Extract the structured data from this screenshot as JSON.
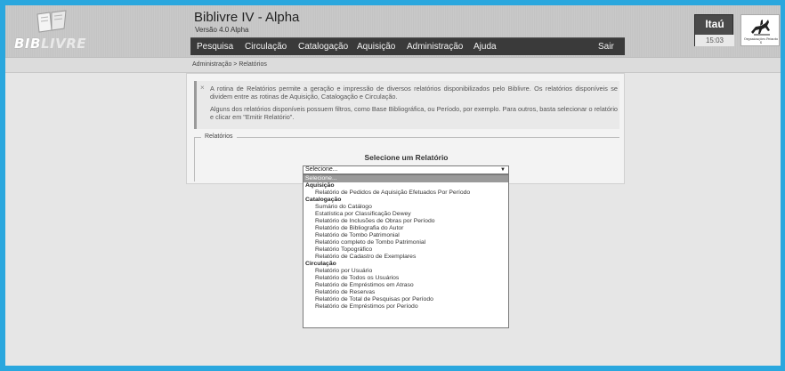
{
  "app": {
    "title": "Biblivre IV - Alpha",
    "version": "Versão 4.0 Alpha",
    "logo_text_a": "BIB",
    "logo_text_b": "LIVRE"
  },
  "menu": {
    "items": [
      "Pesquisa",
      "Circulação",
      "Catalogação",
      "Aquisição",
      "Administração",
      "Ajuda"
    ],
    "logout": "Sair"
  },
  "bank": {
    "name": "Itaú",
    "time": "15:03"
  },
  "org": {
    "text": "Organizações Peixoto S"
  },
  "breadcrumb": "Administração > Relatórios",
  "info": {
    "close_icon": "×",
    "p1": "A rotina de Relatórios permite a geração e impressão de diversos relatórios disponibilizados pelo Biblivre. Os relatórios disponíveis se dividem entre as rotinas de Aquisição, Catalogação e Circulação.",
    "p2": "Alguns dos relatórios disponíveis possuem filtros, como Base Bibliográfica, ou Período, por exemplo. Para outros, basta selecionar o relatório e clicar em \"Emitir Relatório\"."
  },
  "reports": {
    "legend": "Relatórios",
    "heading": "Selecione um Relatório",
    "selected": "Selecione...",
    "arrow": "▼",
    "options": [
      {
        "type": "selected",
        "label": "Selecione..."
      },
      {
        "type": "group",
        "label": "Aquisição"
      },
      {
        "type": "opt",
        "label": "Relatório de Pedidos de Aquisição Efetuados Por Período"
      },
      {
        "type": "group",
        "label": "Catalogação"
      },
      {
        "type": "opt",
        "label": "Sumário do Catálogo"
      },
      {
        "type": "opt",
        "label": "Estatística por Classificação Dewey"
      },
      {
        "type": "opt",
        "label": "Relatório de Inclusões de Obras por Período"
      },
      {
        "type": "opt",
        "label": "Relatório de Bibliografia do Autor"
      },
      {
        "type": "opt",
        "label": "Relatório de Tombo Patrimonial"
      },
      {
        "type": "opt",
        "label": "Relatório completo de Tombo Patrimonial"
      },
      {
        "type": "opt",
        "label": "Relatório Topográfico"
      },
      {
        "type": "opt",
        "label": "Relatório de Cadastro de Exemplares"
      },
      {
        "type": "group",
        "label": "Circulação"
      },
      {
        "type": "opt",
        "label": "Relatório por Usuário"
      },
      {
        "type": "opt",
        "label": "Relatório de Todos os Usuários"
      },
      {
        "type": "opt",
        "label": "Relatório de Empréstimos em Atraso"
      },
      {
        "type": "opt",
        "label": "Relatório de Reservas"
      },
      {
        "type": "opt",
        "label": "Relatório de Total de Pesquisas por Período"
      },
      {
        "type": "opt",
        "label": "Relatório de Empréstimos por Período"
      }
    ]
  },
  "colors": {
    "frame": "#2aa7de",
    "menubar": "#3a3a3a",
    "selected_option": "#9a9a9a"
  }
}
